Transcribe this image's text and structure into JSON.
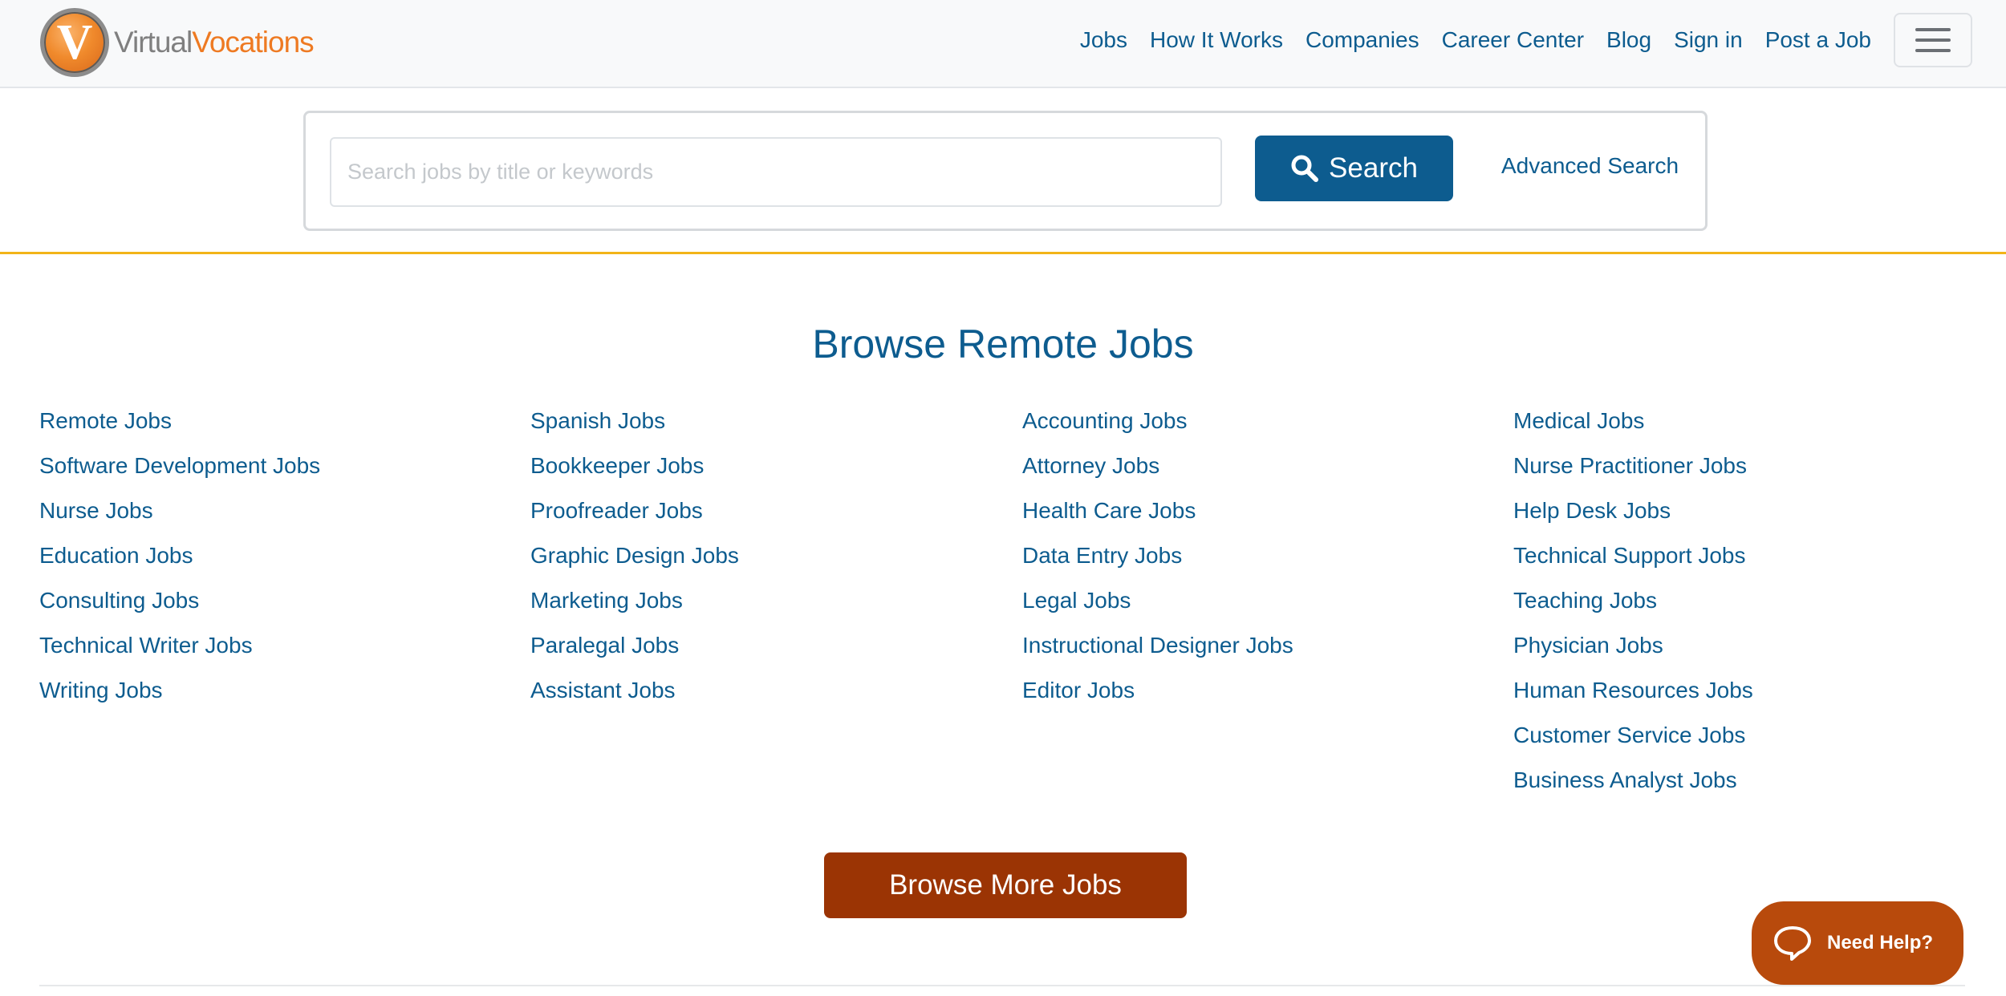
{
  "brand": {
    "logo_letter": "V",
    "name_part1": "Virtual",
    "name_part2": "Vocations",
    "colors": {
      "primary": "#0d5c8f",
      "accent_orange": "#ee7a22",
      "accent_rule": "#f2b418",
      "cta": "#9b3404"
    }
  },
  "nav": {
    "links": [
      "Jobs",
      "How It Works",
      "Companies",
      "Career Center",
      "Blog",
      "Sign in",
      "Post a Job"
    ],
    "menu_icon": "hamburger-icon"
  },
  "search": {
    "placeholder": "Search jobs by title or keywords",
    "value": "",
    "button_label": "Search",
    "button_icon": "search-icon",
    "advanced_label": "Advanced Search"
  },
  "browse": {
    "title": "Browse Remote Jobs",
    "columns": [
      [
        "Remote Jobs",
        "Software Development Jobs",
        "Nurse Jobs",
        "Education Jobs",
        "Consulting Jobs",
        "Technical Writer Jobs",
        "Writing Jobs"
      ],
      [
        "Spanish Jobs",
        "Bookkeeper Jobs",
        "Proofreader Jobs",
        "Graphic Design Jobs",
        "Marketing Jobs",
        "Paralegal Jobs",
        "Assistant Jobs"
      ],
      [
        "Accounting Jobs",
        "Attorney Jobs",
        "Health Care Jobs",
        "Data Entry Jobs",
        "Legal Jobs",
        "Instructional Designer Jobs",
        "Editor Jobs"
      ],
      [
        "Medical Jobs",
        "Nurse Practitioner Jobs",
        "Help Desk Jobs",
        "Technical Support Jobs",
        "Teaching Jobs",
        "Physician Jobs",
        "Human Resources Jobs",
        "Customer Service Jobs",
        "Business Analyst Jobs"
      ]
    ],
    "more_button": "Browse More Jobs"
  },
  "help_widget": {
    "label": "Need Help?",
    "icon": "chat-bubble-icon"
  }
}
